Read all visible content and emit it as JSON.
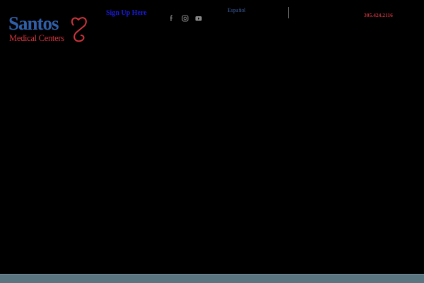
{
  "header": {
    "logo": {
      "main": "Santos",
      "sub": "Medical Centers"
    },
    "signup_label": "Sign Up Here",
    "social": [
      "facebook-icon",
      "instagram-icon",
      "youtube-icon"
    ],
    "language_label": "Español",
    "phone": "305.424.2116"
  },
  "colors": {
    "background": "#000000",
    "brand_blue": "#2f5fa8",
    "brand_red": "#d2343c",
    "footer_bar": "#5a7480"
  }
}
